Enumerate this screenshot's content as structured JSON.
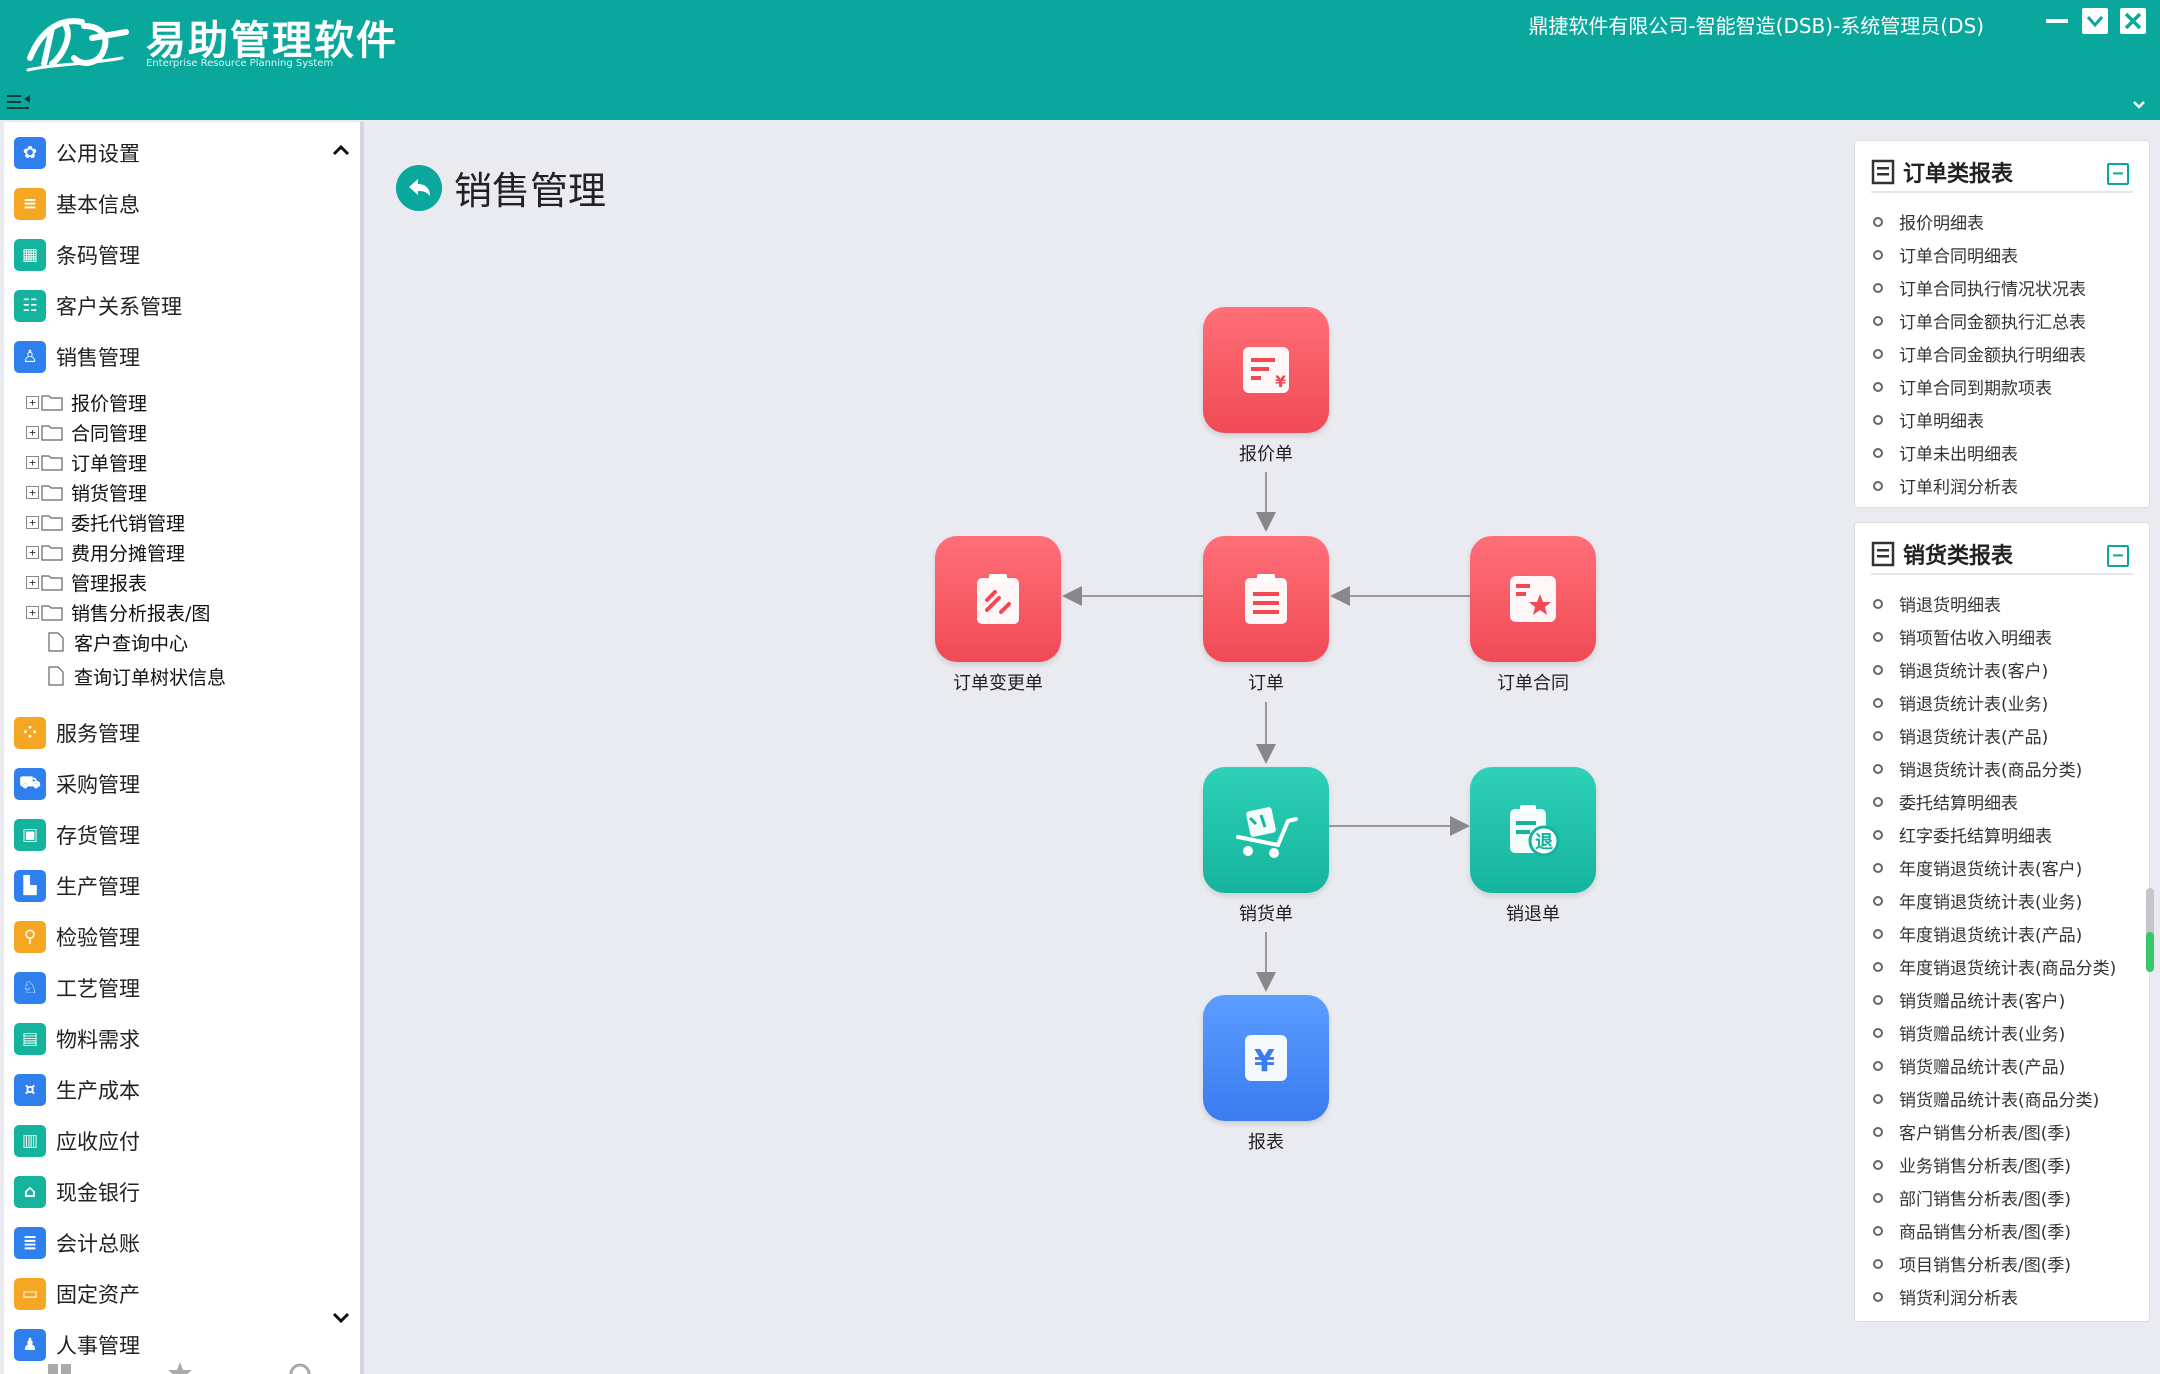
{
  "header": {
    "app_title": "易助管理软件",
    "app_subtitle": "Enterprise Resource Planning System",
    "company_info": "鼎捷软件有限公司-智能智造(DSB)-系统管理员(DS)"
  },
  "sidebar": {
    "modules": [
      {
        "label": "公用设置",
        "icon": "gear-icon",
        "color": "#2f80ed"
      },
      {
        "label": "基本信息",
        "icon": "document-icon",
        "color": "#f5a623"
      },
      {
        "label": "条码管理",
        "icon": "barcode-icon",
        "color": "#14b39d"
      },
      {
        "label": "客户关系管理",
        "icon": "customers-icon",
        "color": "#14b39d"
      },
      {
        "label": "销售管理",
        "icon": "sales-icon",
        "color": "#2f80ed"
      }
    ],
    "sub_items": [
      {
        "label": "报价管理",
        "type": "folder"
      },
      {
        "label": "合同管理",
        "type": "folder"
      },
      {
        "label": "订单管理",
        "type": "folder"
      },
      {
        "label": "销货管理",
        "type": "folder"
      },
      {
        "label": "委托代销管理",
        "type": "folder"
      },
      {
        "label": "费用分摊管理",
        "type": "folder"
      },
      {
        "label": "管理报表",
        "type": "folder"
      },
      {
        "label": "销售分析报表/图",
        "type": "folder"
      },
      {
        "label": "客户查询中心",
        "type": "doc"
      },
      {
        "label": "查询订单树状信息",
        "type": "doc"
      }
    ],
    "modules_after": [
      {
        "label": "服务管理",
        "icon": "service-icon",
        "color": "#f5a623"
      },
      {
        "label": "采购管理",
        "icon": "purchase-cart-icon",
        "color": "#2f80ed"
      },
      {
        "label": "存货管理",
        "icon": "inventory-icon",
        "color": "#14b39d"
      },
      {
        "label": "生产管理",
        "icon": "factory-icon",
        "color": "#2f80ed"
      },
      {
        "label": "检验管理",
        "icon": "inspection-icon",
        "color": "#f5a623"
      },
      {
        "label": "工艺管理",
        "icon": "process-icon",
        "color": "#2f80ed"
      },
      {
        "label": "物料需求",
        "icon": "calendar-icon",
        "color": "#14b39d"
      },
      {
        "label": "生产成本",
        "icon": "cost-icon",
        "color": "#2f80ed"
      },
      {
        "label": "应收应付",
        "icon": "receivable-icon",
        "color": "#14b39d"
      },
      {
        "label": "现金银行",
        "icon": "bank-icon",
        "color": "#14b39d"
      },
      {
        "label": "会计总账",
        "icon": "ledger-icon",
        "color": "#2f80ed"
      },
      {
        "label": "固定资产",
        "icon": "wallet-icon",
        "color": "#f5a623"
      },
      {
        "label": "人事管理",
        "icon": "person-icon",
        "color": "#2f80ed"
      }
    ]
  },
  "main": {
    "title": "销售管理",
    "flow": {
      "quotation": "报价单",
      "order": "订单",
      "order_change": "订单变更单",
      "order_contract": "订单合同",
      "delivery": "销货单",
      "return": "销退单",
      "report": "报表"
    }
  },
  "panels": {
    "order_reports": {
      "title": "订单类报表",
      "items": [
        "报价明细表",
        "订单合同明细表",
        "订单合同执行情况状况表",
        "订单合同金额执行汇总表",
        "订单合同金额执行明细表",
        "订单合同到期款项表",
        "订单明细表",
        "订单未出明细表",
        "订单利润分析表"
      ]
    },
    "sales_reports": {
      "title": "销货类报表",
      "items": [
        "销退货明细表",
        "销项暂估收入明细表",
        "销退货统计表(客户)",
        "销退货统计表(业务)",
        "销退货统计表(产品)",
        "销退货统计表(商品分类)",
        "委托结算明细表",
        "红字委托结算明细表",
        "年度销退货统计表(客户)",
        "年度销退货统计表(业务)",
        "年度销退货统计表(产品)",
        "年度销退货统计表(商品分类)",
        "销货赠品统计表(客户)",
        "销货赠品统计表(业务)",
        "销货赠品统计表(产品)",
        "销货赠品统计表(商品分类)",
        "客户销售分析表/图(季)",
        "业务销售分析表/图(季)",
        "部门销售分析表/图(季)",
        "商品销售分析表/图(季)",
        "项目销售分析表/图(季)",
        "销货利润分析表"
      ]
    }
  },
  "colors": {
    "header_bg": "#0aa89c",
    "node_red": "#f04a55",
    "node_teal": "#14b39d",
    "node_blue": "#3a7bf0"
  }
}
